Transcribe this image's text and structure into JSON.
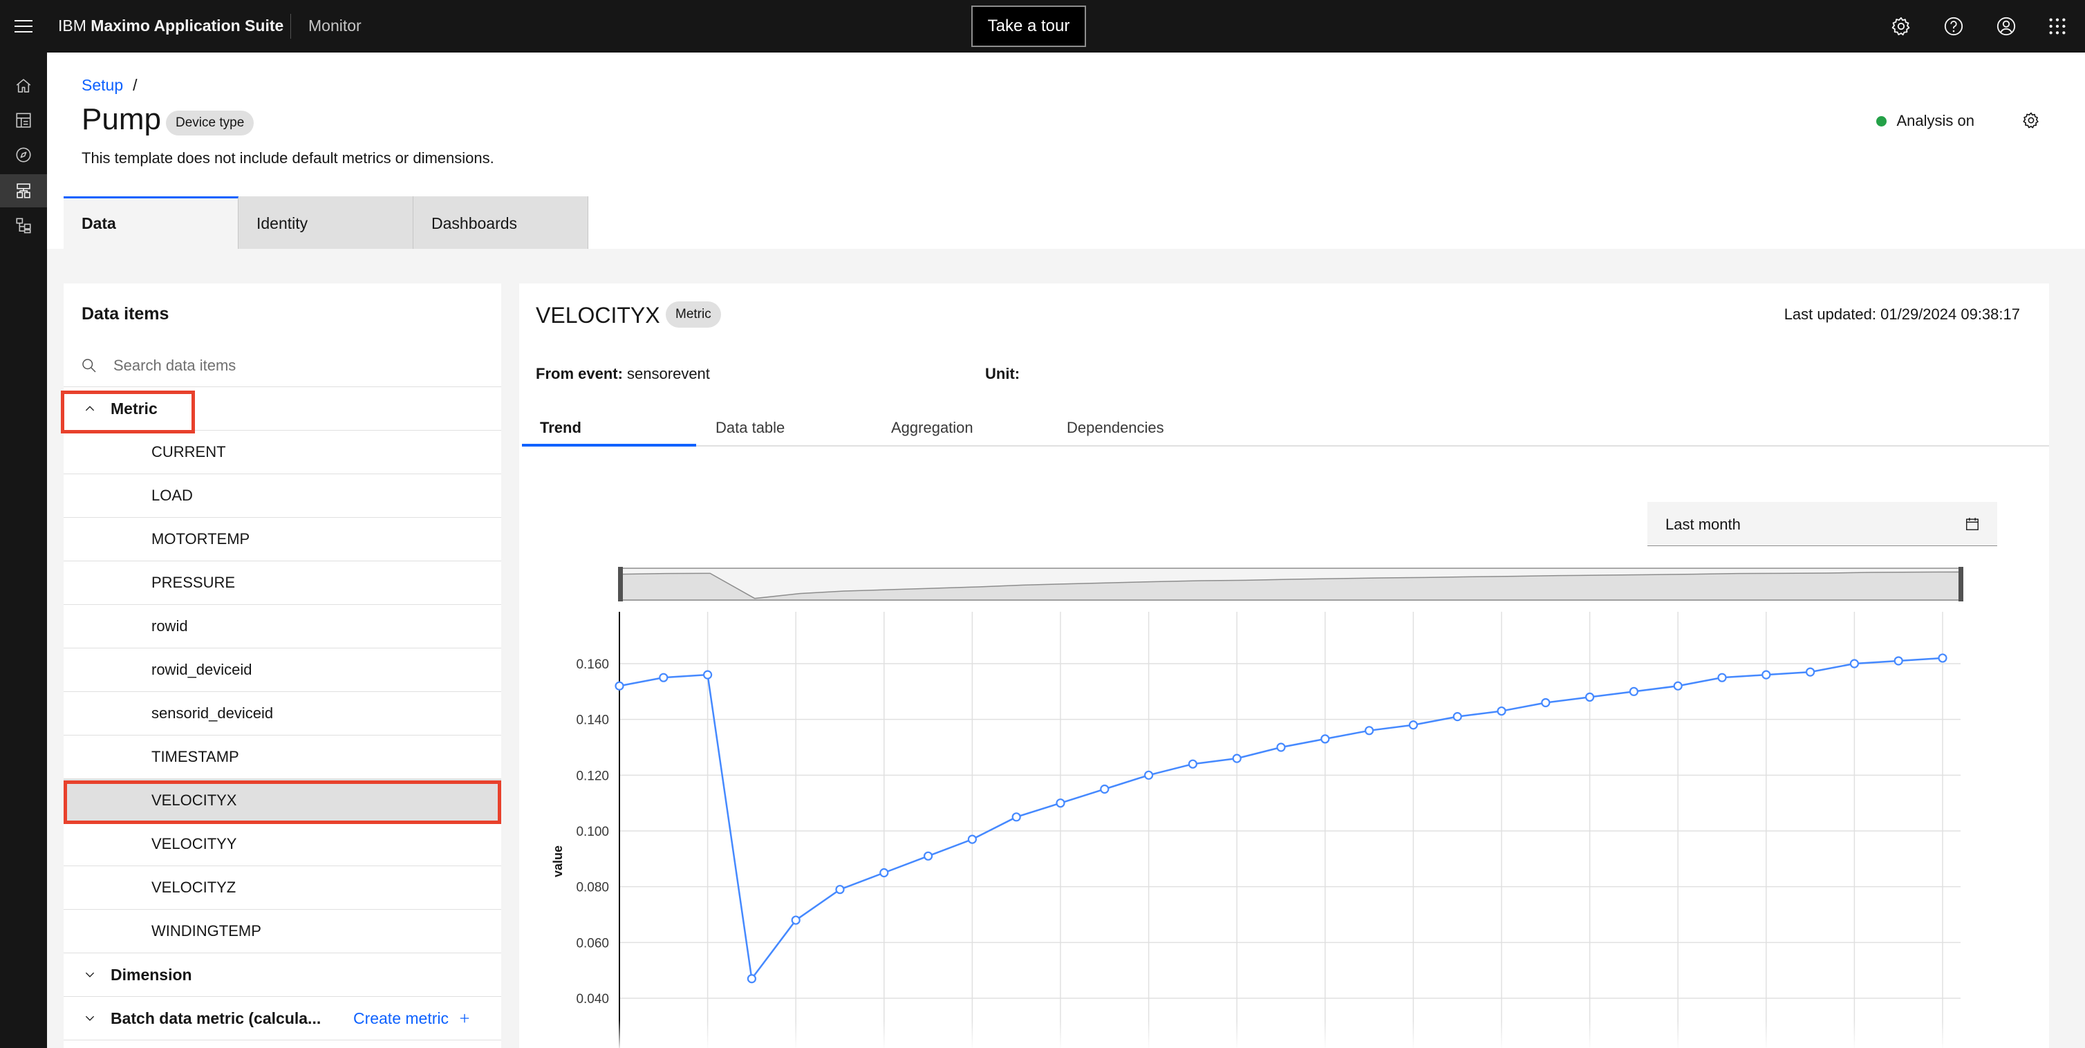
{
  "header": {
    "brand_prefix": "IBM",
    "brand_name": "Maximo Application Suite",
    "product": "Monitor",
    "tour_label": "Take a tour"
  },
  "page": {
    "breadcrumb": "Setup",
    "breadcrumb_sep": "/",
    "title": "Pump",
    "type_badge": "Device type",
    "description": "This template does not include default metrics or dimensions.",
    "analysis_status": "Analysis on",
    "status_color": "#24a148",
    "accent_color": "#0f62fe",
    "tabs": [
      {
        "label": "Data",
        "active": true
      },
      {
        "label": "Identity",
        "active": false
      },
      {
        "label": "Dashboards",
        "active": false
      }
    ]
  },
  "items_panel": {
    "title": "Data items",
    "search_placeholder": "Search data items",
    "groups": {
      "metric": "Metric",
      "dimension": "Dimension",
      "batch": "Batch data metric (calcula...",
      "create_label": "Create metric"
    },
    "metric_items": [
      "CURRENT",
      "LOAD",
      "MOTORTEMP",
      "PRESSURE",
      "rowid",
      "rowid_deviceid",
      "sensorid_deviceid",
      "TIMESTAMP",
      "VELOCITYX",
      "VELOCITYY",
      "VELOCITYZ",
      "WINDINGTEMP"
    ],
    "selected": "VELOCITYX"
  },
  "detail": {
    "title": "VELOCITYX",
    "badge": "Metric",
    "last_updated": "Last updated: 01/29/2024 09:38:17",
    "from_event_label": "From event:",
    "from_event_value": "sensorevent",
    "unit_label": "Unit:",
    "unit_value": "",
    "tabs": [
      {
        "label": "Trend",
        "active": true
      },
      {
        "label": "Data table",
        "active": false
      },
      {
        "label": "Aggregation",
        "active": false
      },
      {
        "label": "Dependencies",
        "active": false
      }
    ],
    "range_label": "Last month"
  },
  "chart_data": {
    "type": "line",
    "ylabel": "value",
    "xlabel": "",
    "yticks": [
      "0.160",
      "0.140",
      "0.120",
      "0.100",
      "0.080",
      "0.060",
      "0.040"
    ],
    "ylim": [
      0.04,
      0.16
    ],
    "line_color": "#4589ff",
    "series": [
      {
        "values": [
          0.152,
          0.155,
          0.156,
          0.047,
          0.068,
          0.079,
          0.085,
          0.091,
          0.097,
          0.105,
          0.11,
          0.115,
          0.12,
          0.124,
          0.126,
          0.13,
          0.133,
          0.136,
          0.138,
          0.141,
          0.143,
          0.146,
          0.148,
          0.15,
          0.152,
          0.155,
          0.156,
          0.157,
          0.16,
          0.161,
          0.162
        ]
      }
    ]
  }
}
